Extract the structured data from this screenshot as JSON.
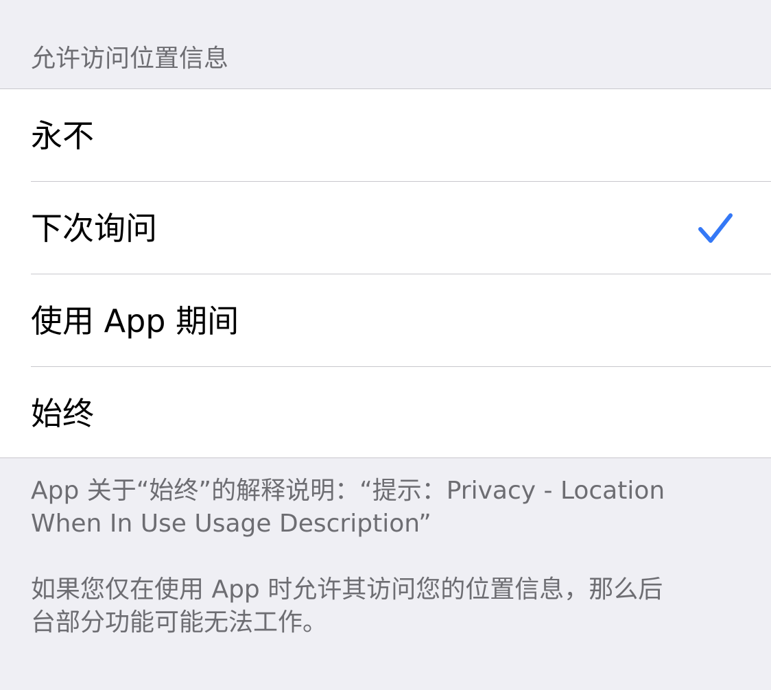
{
  "header": {
    "title": "允许访问位置信息"
  },
  "options": [
    {
      "label": "永不",
      "selected": false
    },
    {
      "label": "下次询问",
      "selected": true
    },
    {
      "label": "使用 App 期间",
      "selected": false
    },
    {
      "label": "始终",
      "selected": false
    }
  ],
  "footer": {
    "explanation": "App 关于“始终”的解释说明：“提示：Privacy - Location\nWhen In Use Usage Description”",
    "note": "如果您仅在使用 App 时允许其访问您的位置信息，那么后\n台部分功能可能无法工作。"
  },
  "icons": {
    "check": "checkmark-icon"
  },
  "colors": {
    "accent": "#3478f6",
    "background": "#efeff4",
    "secondary_text": "#6d6d72"
  }
}
